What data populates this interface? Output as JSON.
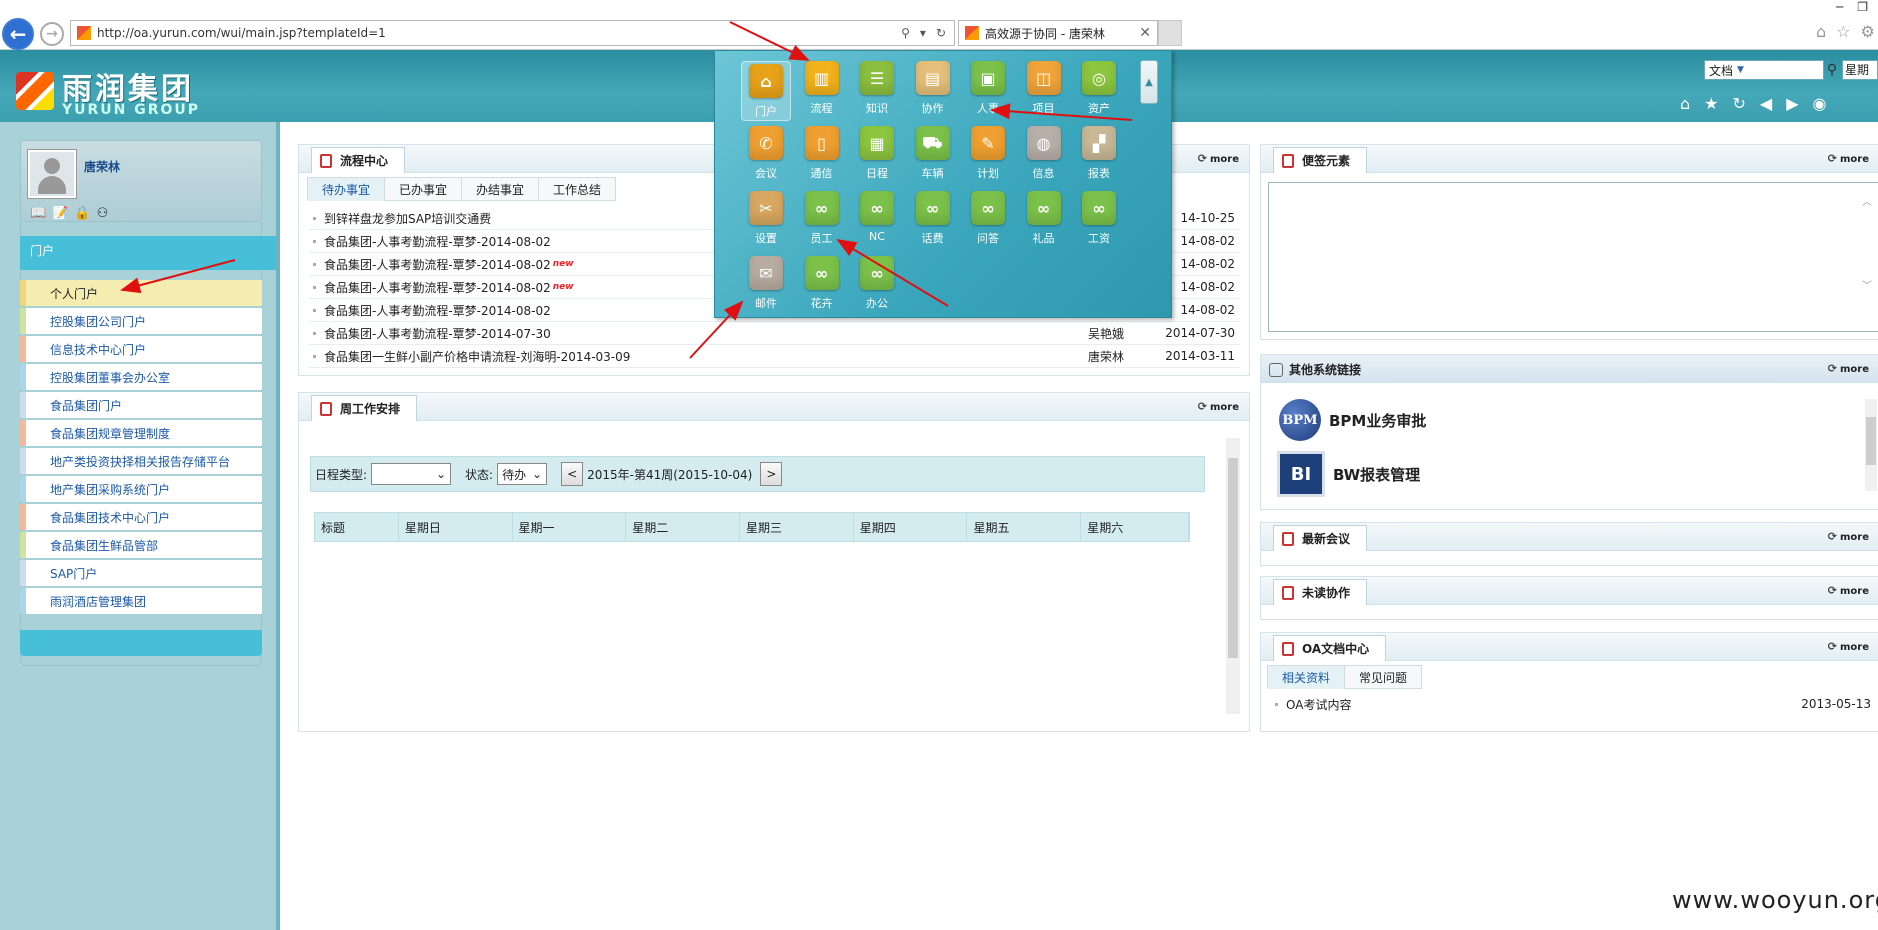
{
  "browser": {
    "url": "http://oa.yurun.com/wui/main.jsp?templateId=1",
    "tab_title": "高效源于协同 - 唐荣林",
    "back_icon": "back-arrow-icon",
    "forward_icon": "forward-arrow-icon"
  },
  "header": {
    "logo_cn": "雨润集团",
    "logo_en": "YURUN GROUP",
    "search_type": "文档",
    "weekday": "星期二",
    "colors": {
      "header": "#3c9fb0",
      "accent": "#48bfd8"
    }
  },
  "user": {
    "name": "唐荣林"
  },
  "portal": {
    "heading": "门户",
    "items": [
      "个人门户",
      "控股集团公司门户",
      "信息技术中心门户",
      "控股集团董事会办公室",
      "食品集团门户",
      "食品集团规章管理制度",
      "地产类投资抉择相关报告存储平台",
      "地产集团采购系统门户",
      "食品集团技术中心门户",
      "食品集团生鲜品管部",
      "SAP门户",
      "雨润酒店管理集团"
    ]
  },
  "flow": {
    "title": "流程中心",
    "more": "more",
    "tabs": [
      "待办事宜",
      "已办事宜",
      "办结事宜",
      "工作总结"
    ],
    "rows": [
      {
        "text": "到锌祥盘龙参加SAP培训交通费",
        "who": "",
        "date": "14-10-25",
        "new": ""
      },
      {
        "text": "食品集团-人事考勤流程-覃梦-2014-08-02",
        "who": "",
        "date": "14-08-02",
        "new": ""
      },
      {
        "text": "食品集团-人事考勤流程-覃梦-2014-08-02",
        "who": "",
        "date": "14-08-02",
        "new": "new"
      },
      {
        "text": "食品集团-人事考勤流程-覃梦-2014-08-02",
        "who": "",
        "date": "14-08-02",
        "new": "new"
      },
      {
        "text": "食品集团-人事考勤流程-覃梦-2014-08-02",
        "who": "",
        "date": "14-08-02",
        "new": ""
      },
      {
        "text": "食品集团-人事考勤流程-覃梦-2014-07-30",
        "who": "吴艳娥",
        "date": "2014-07-30",
        "new": ""
      },
      {
        "text": "食品集团一生鲜小副产价格申请流程-刘海明-2014-03-09",
        "who": "唐荣林",
        "date": "2014-03-11",
        "new": ""
      }
    ]
  },
  "week": {
    "title": "周工作安排",
    "more": "more",
    "type_label": "日程类型:",
    "status_label": "状态:",
    "status_value": "待办",
    "prev": "<",
    "next": ">",
    "period": "2015年-第41周(2015-10-04)",
    "columns": [
      "标题",
      "星期日",
      "星期一",
      "星期二",
      "星期三",
      "星期四",
      "星期五",
      "星期六"
    ]
  },
  "menu": {
    "items": [
      {
        "label": "门户",
        "color": "#e8a21a",
        "glyph": "⌂"
      },
      {
        "label": "流程",
        "color": "#f2b21c",
        "glyph": "▥"
      },
      {
        "label": "知识",
        "color": "#8cbf3f",
        "glyph": "☰"
      },
      {
        "label": "协作",
        "color": "#e6c07a",
        "glyph": "▤"
      },
      {
        "label": "人事",
        "color": "#7cc24a",
        "glyph": "▣"
      },
      {
        "label": "项目",
        "color": "#f0a43a",
        "glyph": "◫"
      },
      {
        "label": "资产",
        "color": "#8cc63f",
        "glyph": "◎"
      },
      {
        "label": "会议",
        "color": "#f0a030",
        "glyph": "✆"
      },
      {
        "label": "通信",
        "color": "#f0a030",
        "glyph": "▯"
      },
      {
        "label": "日程",
        "color": "#8cc63f",
        "glyph": "▦"
      },
      {
        "label": "车辆",
        "color": "#7cc24a",
        "glyph": "⛟"
      },
      {
        "label": "计划",
        "color": "#f0a030",
        "glyph": "✎"
      },
      {
        "label": "信息",
        "color": "#b8b0a8",
        "glyph": "◍"
      },
      {
        "label": "报表",
        "color": "#c8b896",
        "glyph": "▞"
      },
      {
        "label": "设置",
        "color": "#d8a860",
        "glyph": "✂"
      },
      {
        "label": "员工",
        "color": "#7cc24a",
        "glyph": "∞"
      },
      {
        "label": "NC",
        "color": "#7cc24a",
        "glyph": "∞"
      },
      {
        "label": "话费",
        "color": "#7cc24a",
        "glyph": "∞"
      },
      {
        "label": "问答",
        "color": "#7cc24a",
        "glyph": "∞"
      },
      {
        "label": "礼品",
        "color": "#7cc24a",
        "glyph": "∞"
      },
      {
        "label": "工资",
        "color": "#7cc24a",
        "glyph": "∞"
      },
      {
        "label": "邮件",
        "color": "#b8aca0",
        "glyph": "✉"
      },
      {
        "label": "花卉",
        "color": "#7cc24a",
        "glyph": "∞"
      },
      {
        "label": "办公",
        "color": "#7cc24a",
        "glyph": "∞"
      }
    ]
  },
  "right": {
    "memo_title": "便签元素",
    "links_title": "其他系统链接",
    "links": [
      {
        "badge": "BPM",
        "label": "BPM业务审批"
      },
      {
        "badge": "BI",
        "label": "BW报表管理"
      }
    ],
    "meeting_title": "最新会议",
    "unread_title": "未读协作",
    "oa_title": "OA文档中心",
    "oa_tabs": [
      "相关资料",
      "常见问题"
    ],
    "oa_rows": [
      {
        "text": "OA考试内容",
        "date": "2013-05-13"
      }
    ],
    "more": "more"
  },
  "watermark": "www.wooyun.org"
}
